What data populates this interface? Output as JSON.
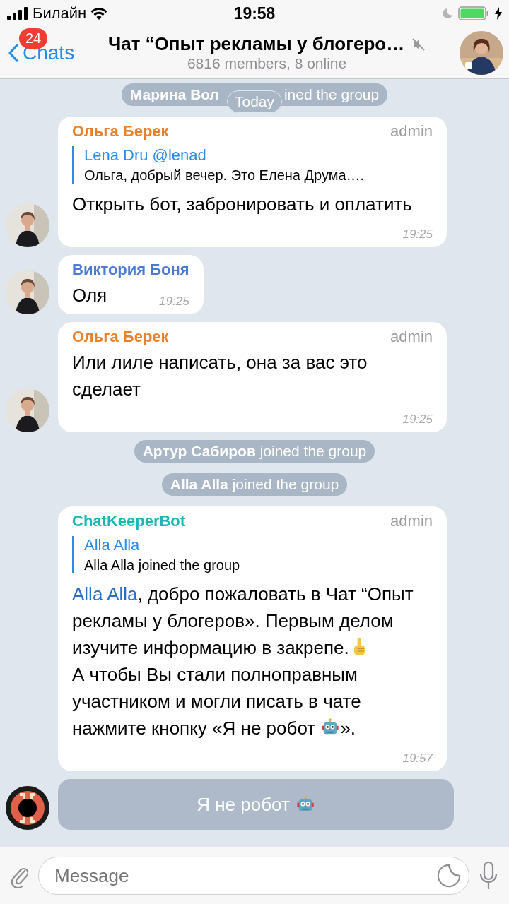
{
  "status_bar": {
    "carrier": "Билайн",
    "time": "19:58",
    "do_not_disturb": true,
    "charging": true
  },
  "nav": {
    "back_label": "Chats",
    "badge": "24",
    "title": "Чат “Опыт рекламы у блогеро…",
    "subtitle": "6816 members, 8 online",
    "muted": true
  },
  "feed": [
    {
      "kind": "service",
      "name": "Марина Вол",
      "text": "ined the group",
      "overlay": "Today"
    },
    {
      "kind": "message",
      "sender": "Ольга Берек",
      "color": "#e8812b",
      "role": "admin",
      "reply": {
        "author": "Lena Dru @lenad",
        "text": "Ольга, добрый вечер. Это Елена Друма…."
      },
      "body": [
        {
          "kind": "text",
          "text": "Открыть бот, забронировать и оплатить"
        }
      ],
      "time": "19:25",
      "avatar": true
    },
    {
      "kind": "message",
      "sender": "Виктория Боня",
      "color": "#4a7ad6",
      "body": [
        {
          "kind": "text",
          "text": "Оля"
        }
      ],
      "time": "19:25",
      "avatar": true
    },
    {
      "kind": "message",
      "sender": "Ольга Берек",
      "color": "#e8812b",
      "role": "admin",
      "body": [
        {
          "kind": "text",
          "text": "Или лиле написать, она за вас это сделает"
        }
      ],
      "time": "19:25",
      "avatar": true
    },
    {
      "kind": "service",
      "name": "Артур Сабиров",
      "text": "joined the group"
    },
    {
      "kind": "service",
      "name": "Alla Alla",
      "text": "joined the group"
    },
    {
      "kind": "message",
      "sender": "ChatKeeperBot",
      "color": "#1fb5b5",
      "role": "admin",
      "reply": {
        "author": "Alla Alla",
        "text": "Alla Alla joined the group"
      },
      "body": [
        {
          "kind": "mention",
          "text": "Alla Alla"
        },
        {
          "kind": "text",
          "text": ", добро пожаловать в Чат “Опыт рекламы у блогеров». Первым делом изучите информацию в закрепе."
        },
        {
          "kind": "finger"
        },
        {
          "kind": "break"
        },
        {
          "kind": "text",
          "text": "А чтобы Вы стали полноправным участником и могли писать в чате нажмите кнопку «Я не робот "
        },
        {
          "kind": "robot"
        },
        {
          "kind": "text",
          "text": "»."
        }
      ],
      "time": "19:57"
    },
    {
      "kind": "bot_button",
      "label": "Я не робот"
    }
  ],
  "composer": {
    "placeholder": "Message"
  }
}
